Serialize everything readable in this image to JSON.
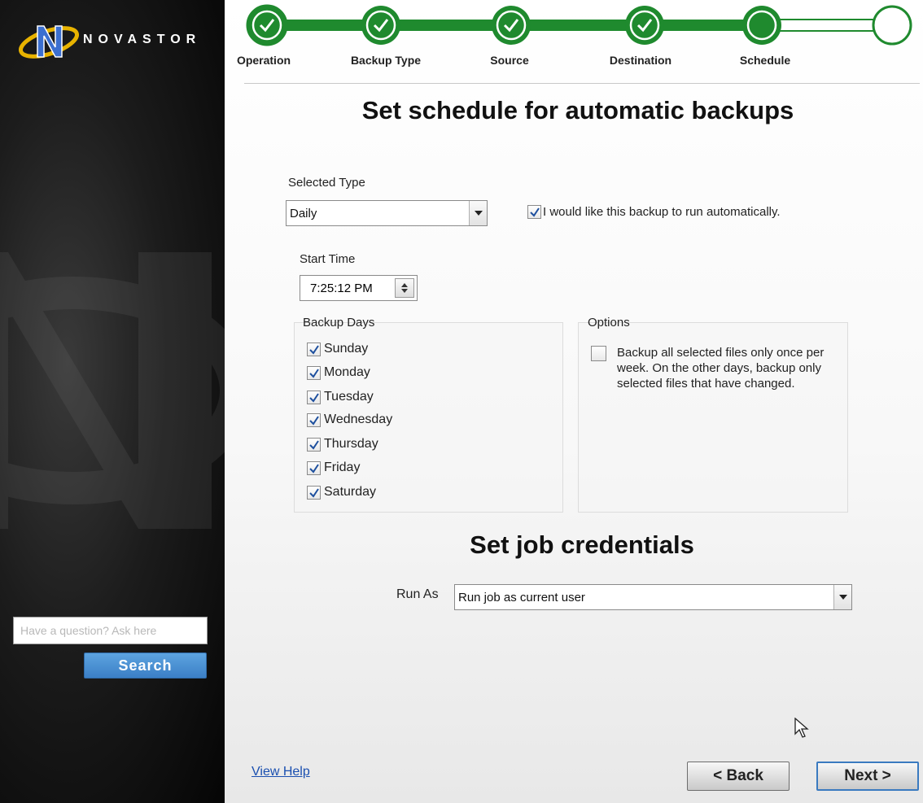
{
  "brand": {
    "name": "NOVASTOR"
  },
  "colors": {
    "step_green": "#1f8a2e",
    "accent_blue": "#3b7fc6"
  },
  "sidebar": {
    "ask_placeholder": "Have a question? Ask here",
    "search_label": "Search"
  },
  "steps": [
    {
      "label": "Operation",
      "state": "done"
    },
    {
      "label": "Backup Type",
      "state": "done"
    },
    {
      "label": "Source",
      "state": "done"
    },
    {
      "label": "Destination",
      "state": "done"
    },
    {
      "label": "Schedule",
      "state": "current"
    },
    {
      "label": "",
      "state": "pending"
    }
  ],
  "schedule": {
    "title": "Set schedule for automatic backups",
    "selected_type_label": "Selected Type",
    "selected_type_value": "Daily",
    "auto_run_label": "I would like this backup to run automatically.",
    "auto_run_checked": true,
    "start_time_label": "Start Time",
    "start_time_value": "7:25:12 PM",
    "backup_days_label": "Backup Days",
    "days": [
      {
        "label": "Sunday",
        "checked": true
      },
      {
        "label": "Monday",
        "checked": true
      },
      {
        "label": "Tuesday",
        "checked": true
      },
      {
        "label": "Wednesday",
        "checked": true
      },
      {
        "label": "Thursday",
        "checked": true
      },
      {
        "label": "Friday",
        "checked": true
      },
      {
        "label": "Saturday",
        "checked": true
      }
    ],
    "options_label": "Options",
    "option_weekly_text": "Backup all selected files only once per week. On the other days, backup only selected files that have changed.",
    "option_weekly_checked": false
  },
  "credentials": {
    "title": "Set job credentials",
    "run_as_label": "Run As",
    "run_as_value": "Run job as current user"
  },
  "footer": {
    "help_label": "View Help",
    "back_label": "< Back",
    "next_label": "Next >"
  }
}
